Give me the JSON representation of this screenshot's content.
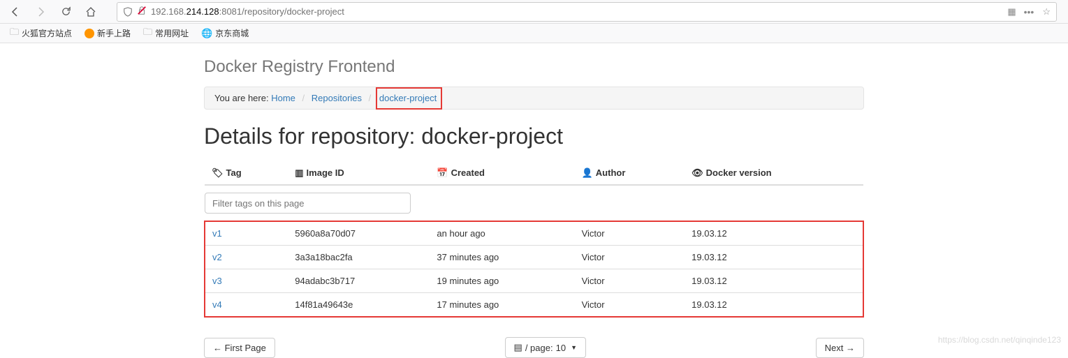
{
  "browser": {
    "url_pre": "192.168.",
    "url_host": "214.128",
    "url_port_path": ":8081/repository/docker-project"
  },
  "bookmarks": {
    "b1": "火狐官方站点",
    "b2": "新手上路",
    "b3": "常用网址",
    "b4": "京东商城"
  },
  "app_title": "Docker Registry Frontend",
  "breadcrumb": {
    "you_are_here": "You are here:",
    "home": "Home",
    "repositories": "Repositories",
    "current": "docker-project"
  },
  "page_heading": "Details for repository: docker-project",
  "columns": {
    "tag": "Tag",
    "image_id": "Image ID",
    "created": "Created",
    "author": "Author",
    "docker_version": "Docker version"
  },
  "filter_placeholder": "Filter tags on this page",
  "rows": [
    {
      "tag": "v1",
      "image_id": "5960a8a70d07",
      "created": "an hour ago",
      "author": "Victor",
      "docker_version": "19.03.12"
    },
    {
      "tag": "v2",
      "image_id": "3a3a18bac2fa",
      "created": "37 minutes ago",
      "author": "Victor",
      "docker_version": "19.03.12"
    },
    {
      "tag": "v3",
      "image_id": "94adabc3b717",
      "created": "19 minutes ago",
      "author": "Victor",
      "docker_version": "19.03.12"
    },
    {
      "tag": "v4",
      "image_id": "14f81a49643e",
      "created": "17 minutes ago",
      "author": "Victor",
      "docker_version": "19.03.12"
    }
  ],
  "pager": {
    "first": "← First Page",
    "per_page_prefix": "/ page: ",
    "per_page_value": "10",
    "next": "Next →"
  },
  "watermark": "https://blog.csdn.net/qinqinde123"
}
